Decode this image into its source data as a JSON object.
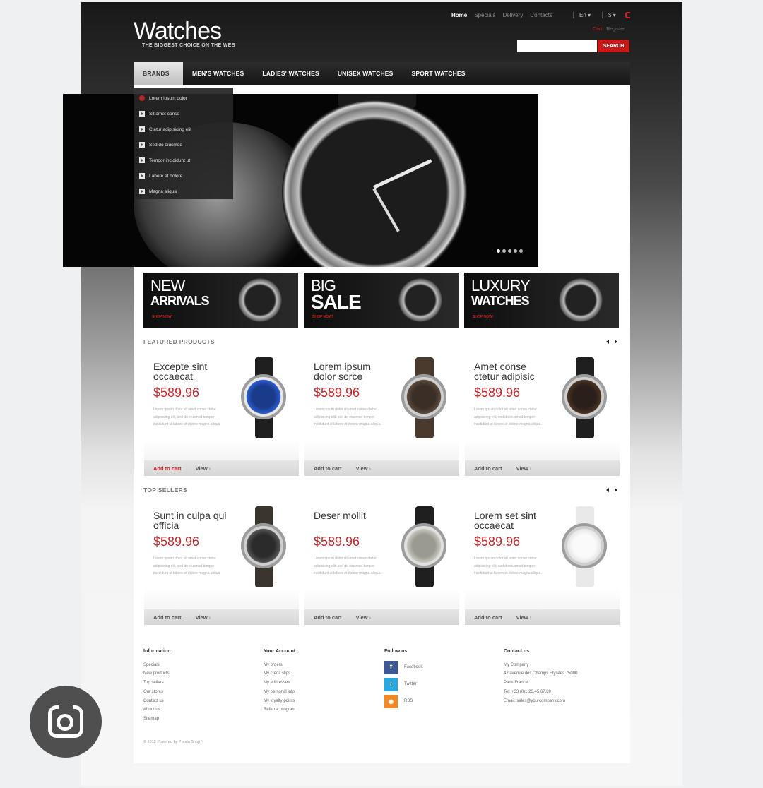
{
  "header": {
    "logo": "Watches",
    "tagline": "THE BIGGEST CHOICE ON THE WEB",
    "top_links": [
      "Home",
      "Specials",
      "Delivery",
      "Contacts"
    ],
    "language": "En ▾",
    "currency": "$ ▾",
    "cart_links": [
      "Cart",
      "Register"
    ],
    "search_placeholder": "",
    "search_button": "SEARCH"
  },
  "nav": {
    "items": [
      "BRANDS",
      "MEN'S WATCHES",
      "LADIES' WATCHES",
      "UNISEX WATCHES",
      "SPORT WATCHES"
    ]
  },
  "brands_dropdown": [
    "Lorem ipsum dolor",
    "Sit amet conse",
    "Ctetur adipisicing elit",
    "Sed do eiusmod",
    "Tempor incididunt ut",
    "Labore et dolore",
    "Magna aliqua"
  ],
  "banners": [
    {
      "line1": "NEW",
      "line2": "ARRIVALS",
      "cta": "SHOP NOW!"
    },
    {
      "line1": "BIG",
      "line2": "SALE",
      "cta": "SHOP NOW!"
    },
    {
      "line1": "LUXURY",
      "line2": "WATCHES",
      "cta": "SHOP NOW!"
    }
  ],
  "featured": {
    "title": "FEATURED PRODUCTS",
    "products": [
      {
        "name": "Excepte sint occaecat",
        "price": "$589.96",
        "desc": "Lorem ipsum dolor sit amet conse ctetur adipisicing elit, sed do eiusmod tempor incididunt ut labore et dolore magna aliqua.",
        "cart": "Add to cart",
        "view": "View"
      },
      {
        "name": "Lorem ipsum dolor sorce",
        "price": "$589.96",
        "desc": "Lorem ipsum dolor sit amet conse ctetur adipisicing elit, sed do eiusmod tempor incididunt ut labore et dolore magna aliqua.",
        "cart": "Add to cart",
        "view": "View"
      },
      {
        "name": "Amet conse ctetur adipisic",
        "price": "$589.96",
        "desc": "Lorem ipsum dolor sit amet conse ctetur adipisicing elit, sed do eiusmod tempor incididunt ut labore et dolore magna aliqua.",
        "cart": "Add to cart",
        "view": "View"
      }
    ]
  },
  "top_sellers": {
    "title": "TOP SELLERS",
    "products": [
      {
        "name": "Sunt in culpa qui officia",
        "price": "$589.96",
        "desc": "Lorem ipsum dolor sit amet conse ctetur adipisicing elit, sed do eiusmod tempor incididunt ut labore et dolore magna aliqua.",
        "cart": "Add to cart",
        "view": "View"
      },
      {
        "name": "Deser mollit",
        "price": "$589.96",
        "desc": "Lorem ipsum dolor sit amet conse ctetur adipisicing elit, sed do eiusmod tempor incididunt ut labore et dolore magna aliqua.",
        "cart": "Add to cart",
        "view": "View"
      },
      {
        "name": "Lorem set sint occaecat",
        "price": "$589.96",
        "desc": "Lorem ipsum dolor sit amet conse ctetur adipisicing elit, sed do eiusmod tempor incididunt ut labore et dolore magna aliqua.",
        "cart": "Add to cart",
        "view": "View"
      }
    ]
  },
  "footer": {
    "information": {
      "title": "Information",
      "links": [
        "Specials",
        "New products",
        "Top sellers",
        "Our stores",
        "Contact us",
        "About us",
        "Sitemap"
      ]
    },
    "account": {
      "title": "Your Account",
      "links": [
        "My orders",
        "My credit slips",
        "My addresses",
        "My personal info",
        "My loyalty points",
        "Referral program"
      ]
    },
    "follow": {
      "title": "Follow us",
      "links": [
        {
          "icon": "f",
          "label": "Facebook",
          "color": "#3b5998"
        },
        {
          "icon": "t",
          "label": "Twitter",
          "color": "#29a9e1"
        },
        {
          "icon": "rss",
          "label": "RSS",
          "color": "#f08a24"
        }
      ]
    },
    "contact": {
      "title": "Contact us",
      "lines": [
        "My Company",
        "42 avenue des Champs Elysées 75000",
        "Paris France",
        "Tel: +33 (0)1.23.45.67.89",
        "Email: sales@yourcompany.com"
      ]
    },
    "copyright": "© 2012 Powered by Presta Shop™"
  }
}
